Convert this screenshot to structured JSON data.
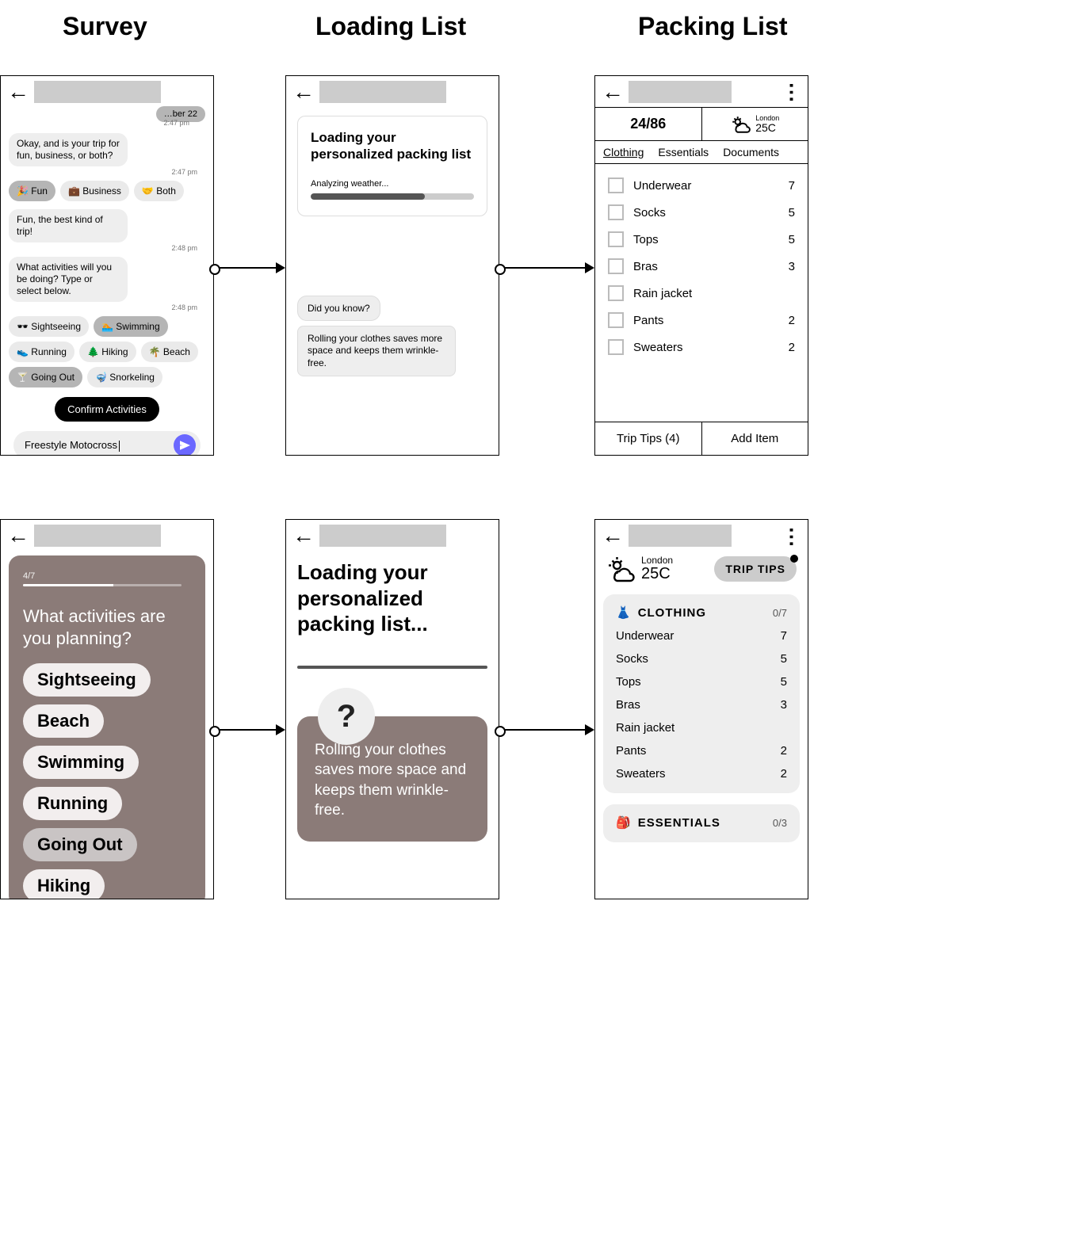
{
  "titles": {
    "survey": "Survey",
    "loading": "Loading List",
    "packing": "Packing List"
  },
  "a1": {
    "date_chip": "…ber 22",
    "ts_overlay": "2:47 pm",
    "msg1": "Okay, and is your trip for fun, business, or both?",
    "ts1": "2:47 pm",
    "type_chips": [
      {
        "icon": "🎉",
        "label": "Fun",
        "selected": true
      },
      {
        "icon": "💼",
        "label": "Business",
        "selected": false
      },
      {
        "icon": "🤝",
        "label": "Both",
        "selected": false
      }
    ],
    "msg2": "Fun, the best kind of trip!",
    "ts2": "2:48 pm",
    "msg3": "What activities will you be doing? Type or select below.",
    "ts3": "2:48 pm",
    "activity_chips": [
      {
        "icon": "🕶️",
        "label": "Sightseeing",
        "selected": false
      },
      {
        "icon": "🏊",
        "label": "Swimming",
        "selected": true
      },
      {
        "icon": "👟",
        "label": "Running",
        "selected": false
      },
      {
        "icon": "🌲",
        "label": "Hiking",
        "selected": false
      },
      {
        "icon": "🌴",
        "label": "Beach",
        "selected": false
      },
      {
        "icon": "🍸",
        "label": "Going Out",
        "selected": true
      },
      {
        "icon": "🤿",
        "label": "Snorkeling",
        "selected": false
      }
    ],
    "confirm": "Confirm Activities",
    "input_value": "Freestyle Motocross"
  },
  "a2": {
    "title": "Loading your personalized packing list",
    "subtitle": "Analyzing weather...",
    "progress_pct": 70,
    "tip_head": "Did you know?",
    "tip_body": "Rolling your clothes saves more space and keeps them wrinkle-free."
  },
  "a3": {
    "count": "24/86",
    "city": "London",
    "temp": "25C",
    "tabs": [
      "Clothing",
      "Essentials",
      "Documents"
    ],
    "active_tab_index": 0,
    "items": [
      {
        "name": "Underwear",
        "qty": "7"
      },
      {
        "name": "Socks",
        "qty": "5"
      },
      {
        "name": "Tops",
        "qty": "5"
      },
      {
        "name": "Bras",
        "qty": "3"
      },
      {
        "name": "Rain jacket",
        "qty": ""
      },
      {
        "name": "Pants",
        "qty": "2"
      },
      {
        "name": "Sweaters",
        "qty": "2"
      }
    ],
    "footer": {
      "tips": "Trip Tips (4)",
      "add": "Add Item"
    }
  },
  "b1": {
    "step": "4/7",
    "step_pct": 57,
    "question": "What activities are you planning?",
    "options": [
      {
        "label": "Sightseeing",
        "selected": false
      },
      {
        "label": "Beach",
        "selected": false
      },
      {
        "label": "Swimming",
        "selected": false
      },
      {
        "label": "Running",
        "selected": false
      },
      {
        "label": "Going Out",
        "selected": true
      },
      {
        "label": "Hiking",
        "selected": false
      }
    ]
  },
  "b2": {
    "title": "Loading your personalized packing list...",
    "tip": "Rolling your clothes saves more space and keeps them wrinkle-free.",
    "q_mark": "?"
  },
  "b3": {
    "city": "London",
    "temp": "25C",
    "tips_chip": "TRIP TIPS",
    "sections": [
      {
        "icon": "👗",
        "title": "CLOTHING",
        "count": "0/7",
        "items": [
          {
            "name": "Underwear",
            "qty": "7"
          },
          {
            "name": "Socks",
            "qty": "5"
          },
          {
            "name": "Tops",
            "qty": "5"
          },
          {
            "name": "Bras",
            "qty": "3"
          },
          {
            "name": "Rain jacket",
            "qty": ""
          },
          {
            "name": "Pants",
            "qty": "2"
          },
          {
            "name": "Sweaters",
            "qty": "2"
          }
        ]
      },
      {
        "icon": "🎒",
        "title": "ESSENTIALS",
        "count": "0/3",
        "items": []
      }
    ]
  }
}
